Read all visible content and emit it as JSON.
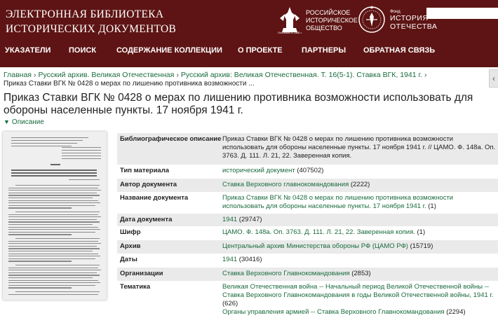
{
  "header": {
    "site_title_line1": "ЭЛЕКТРОННАЯ БИБЛИОТЕКА",
    "site_title_line2": "ИСТОРИЧЕСКИХ ДОКУМЕНТОВ",
    "logo1_line1": "РОССИЙСКОЕ",
    "logo1_line2": "ИСТОРИЧЕСКОЕ",
    "logo1_line3": "ОБЩЕСТВО",
    "logo1_small": "Основано в 1866 г.",
    "logo2_small": "Фонд",
    "logo2_line1": "ИСТОРИЯ",
    "logo2_line2": "ОТЕЧЕСТВА",
    "search_value": ""
  },
  "nav": {
    "items": [
      "УКАЗАТЕЛИ",
      "ПОИСК",
      "СОДЕРЖАНИЕ КОЛЛЕКЦИИ",
      "О ПРОЕКТЕ",
      "ПАРТНЕРЫ",
      "ОБРАТНАЯ СВЯЗЬ"
    ]
  },
  "breadcrumbs": {
    "items": [
      "Главная",
      "Русский архив. Великая Отечественная",
      "Русский архив: Великая Отечественная. Т. 16(5-1). Ставка ВГК, 1941 г."
    ],
    "separator": "›",
    "current": "Приказ Ставки ВГК № 0428 о мерах по лишению противника возможности ..."
  },
  "page": {
    "title": "Приказ Ставки ВГК № 0428 о мерах по лишению противника возможности использовать для обороны населенные пункты. 17 ноября 1941 г.",
    "description_toggle": "Описание"
  },
  "metadata": {
    "bib_label": "Библиографическое описание",
    "bib_value": "Приказ Ставки ВГК № 0428 о мерах по лишению противника возможности использовать для обороны населенные пункты. 17 ноября 1941 г. // ЦАМО. Ф. 148а. Оп. 3763. Д. 111. Л. 21, 22. Заверенная копия.",
    "type_label": "Тип материала",
    "type_link": "исторический документ",
    "type_count": "(407502)",
    "author_label": "Автор документа",
    "author_link": "Ставка Верховного главнокомандования",
    "author_count": "(2222)",
    "name_label": "Название документа",
    "name_link": "Приказ Ставки ВГК № 0428 о мерах по лишению противника возможности использовать для обороны населенные пункты. 17 ноября 1941 г.",
    "name_count": "(1)",
    "date_label": "Дата документа",
    "date_link": "1941",
    "date_count": "(29747)",
    "cipher_label": "Шифр",
    "cipher_link": "ЦАМО. Ф. 148а. Оп. 3763. Д. 111. Л. 21, 22. Заверенная копия.",
    "cipher_count": "(1)",
    "archive_label": "Архив",
    "archive_link": "Центральный архив Министерства обороны РФ (ЦАМО РФ)",
    "archive_count": "(15719)",
    "dates_label": "Даты",
    "dates_link": "1941",
    "dates_count": "(30416)",
    "org_label": "Организации",
    "org_link": "Ставка Верховного Главнокомандования",
    "org_count": "(2853)",
    "theme_label": "Тематика",
    "theme_link1": "Великая Отечественная война -- Начальный период Великой Отечественной войны -- Ставка Верховного Главнокомандования в годы Великой Отечественной войны, 1941 г.",
    "theme_count1": "(626)",
    "theme_link2": "Органы управления армией -- Ставка Верховного Главнокомандования",
    "theme_count2": "(2294)"
  },
  "colors": {
    "header_bg": "#5e1414",
    "link": "#1a6b3e",
    "row_shade": "#eaeaea"
  },
  "icons": {
    "description_toggle": "chevron-down-icon",
    "side_tab": "chevron-left-icon"
  }
}
